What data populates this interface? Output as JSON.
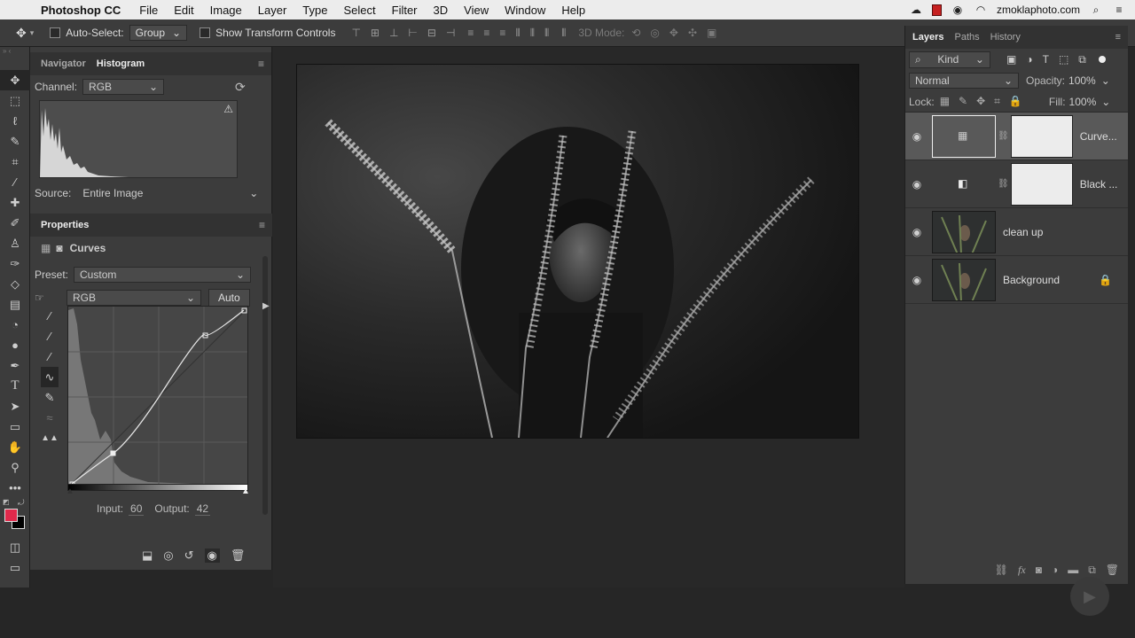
{
  "menubar": {
    "app_name": "Photoshop CC",
    "items": [
      "File",
      "Edit",
      "Image",
      "Layer",
      "Type",
      "Select",
      "Filter",
      "3D",
      "View",
      "Window",
      "Help"
    ],
    "account": "zmoklaphoto.com"
  },
  "options_bar": {
    "auto_select_label": "Auto-Select:",
    "auto_select_value": "Group",
    "show_transform_label": "Show Transform Controls",
    "mode_3d_label": "3D Mode:"
  },
  "navigator_panel": {
    "tabs": [
      "Navigator",
      "Histogram"
    ],
    "active_tab": "Histogram",
    "channel_label": "Channel:",
    "channel_value": "RGB",
    "source_label": "Source:",
    "source_value": "Entire Image"
  },
  "properties_panel": {
    "title": "Properties",
    "adjustment_name": "Curves",
    "preset_label": "Preset:",
    "preset_value": "Custom",
    "channel_value": "RGB",
    "auto_button": "Auto",
    "input_label": "Input:",
    "input_value": "60",
    "output_label": "Output:",
    "output_value": "42"
  },
  "layers_panel": {
    "tabs": [
      "Layers",
      "Paths",
      "History"
    ],
    "active_tab": "Layers",
    "filter_label": "Kind",
    "blend_mode": "Normal",
    "opacity_label": "Opacity:",
    "opacity_value": "100%",
    "lock_label": "Lock:",
    "fill_label": "Fill:",
    "fill_value": "100%",
    "layers": [
      {
        "name": "Curve...",
        "type": "adjustment",
        "selected": true
      },
      {
        "name": "Black ...",
        "type": "adjustment",
        "selected": false
      },
      {
        "name": "clean up",
        "type": "pixel",
        "selected": false
      },
      {
        "name": "Background",
        "type": "pixel",
        "locked": true,
        "selected": false
      }
    ]
  },
  "colors": {
    "foreground": "#e0294b",
    "background": "#000000",
    "accent": "#3d8fd8"
  }
}
